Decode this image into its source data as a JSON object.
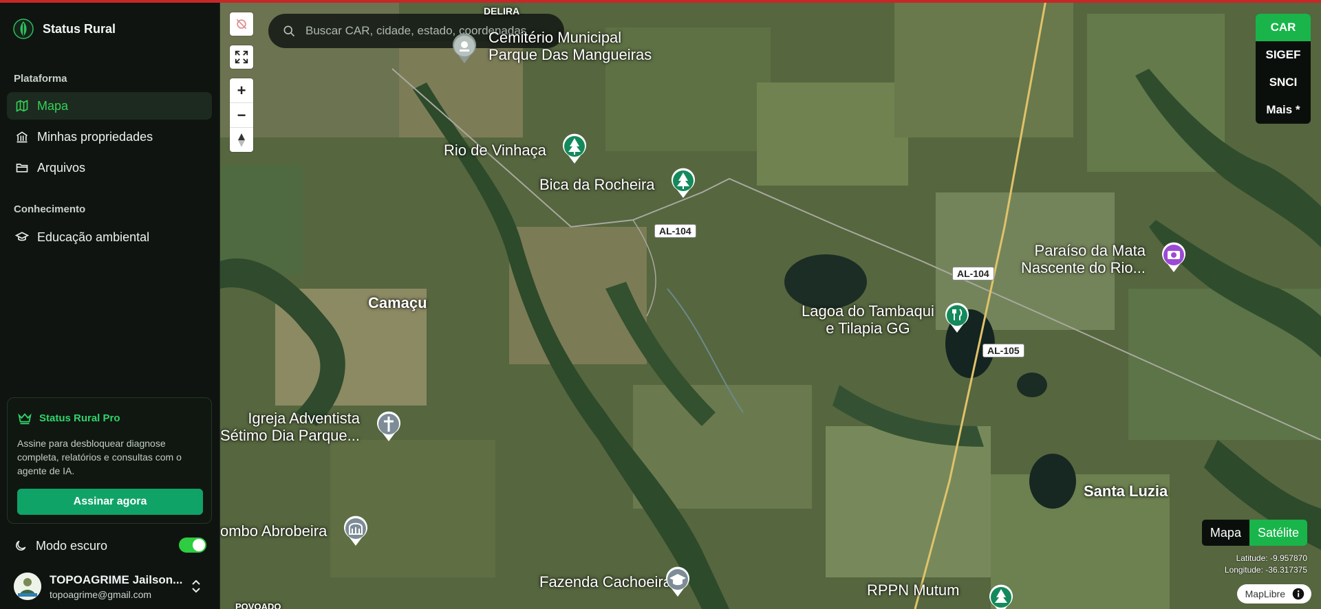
{
  "sidebar": {
    "brand": "Status Rural",
    "section_platform": "Plataforma",
    "nav": [
      {
        "label": "Mapa",
        "icon": "map-icon",
        "active": true
      },
      {
        "label": "Minhas propriedades",
        "icon": "bank-icon"
      },
      {
        "label": "Arquivos",
        "icon": "folder-icon"
      }
    ],
    "section_knowledge": "Conhecimento",
    "knowledge_nav": [
      {
        "label": "Educação ambiental",
        "icon": "graduation-cap-icon"
      }
    ],
    "pro": {
      "title": "Status Rural Pro",
      "description": "Assine para desbloquear diagnose completa, relatórios e consultas com o agente de IA.",
      "button": "Assinar agora"
    },
    "dark_mode": {
      "label": "Modo escuro",
      "enabled": true
    },
    "user": {
      "name": "TOPOAGRIME Jailson...",
      "email": "topoagrime@gmail.com"
    }
  },
  "map": {
    "search": {
      "placeholder": "Buscar CAR, cidade, estado, coordenadas"
    },
    "layers": [
      {
        "label": "CAR",
        "active": true
      },
      {
        "label": "SIGEF"
      },
      {
        "label": "SNCI"
      },
      {
        "label": "Mais *"
      }
    ],
    "styles": [
      {
        "label": "Mapa"
      },
      {
        "label": "Satélite",
        "active": true
      }
    ],
    "coords": {
      "latitude": "Latitude: -9.957870",
      "longitude": "Longitude: -36.317375"
    },
    "attribution": "MapLibre",
    "places": {
      "cemetery": "Cemitério Municipal\nParque Das Mangueiras",
      "rio_vinhaca": "Rio de Vinhaça",
      "bica": "Bica da Rocheira",
      "camacu": "Camaçu",
      "paraiso": "Paraíso da Mata\nNascente do Rio...",
      "lagoa": "Lagoa do Tambaqui\ne Tilapia GG",
      "igreja": "Igreja Adventista\nSétimo Dia Parque...",
      "santa_luzia": "Santa Luzia",
      "abrobeira": "ombo Abrobeira",
      "fazenda": "Fazenda Cachoeira",
      "rppn": "RPPN Mutum",
      "top_clip": "DELIRA",
      "bottom_clip": "POVOADO"
    },
    "roads": {
      "al104_a": "AL-104",
      "al104_b": "AL-104",
      "al105": "AL-105"
    },
    "colors": {
      "accent": "#19b54a",
      "active_nav": "#34d058",
      "pro_button": "#10a367"
    }
  }
}
